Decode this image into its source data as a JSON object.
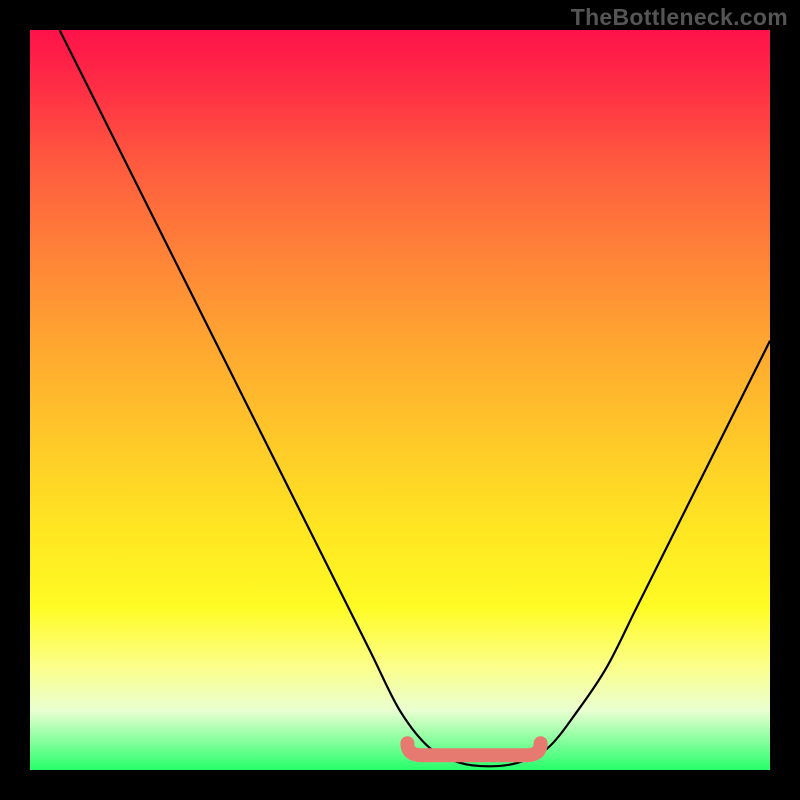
{
  "watermark": "TheBottleneck.com",
  "chart_data": {
    "type": "line",
    "title": "",
    "xlabel": "",
    "ylabel": "",
    "xlim": [
      0,
      100
    ],
    "ylim": [
      0,
      100
    ],
    "series": [
      {
        "name": "bottleneck-curve",
        "x": [
          4,
          10,
          16,
          22,
          28,
          34,
          40,
          46,
          50,
          54,
          58,
          62,
          66,
          70,
          74,
          78,
          82,
          86,
          90,
          94,
          100
        ],
        "values": [
          100,
          88,
          76,
          64,
          52,
          40,
          28,
          16,
          8,
          3,
          1,
          0.5,
          1,
          3,
          8,
          14,
          22,
          30,
          38,
          46,
          58
        ]
      }
    ],
    "annotations": [
      {
        "name": "optimal-range-marker",
        "x_start": 51,
        "x_end": 69,
        "y": 2,
        "color": "#e77a70"
      }
    ],
    "grid": false,
    "legend": false
  },
  "colors": {
    "curve_stroke": "#000000",
    "marker_stroke": "#e77a70",
    "frame_bg": "#000000"
  }
}
